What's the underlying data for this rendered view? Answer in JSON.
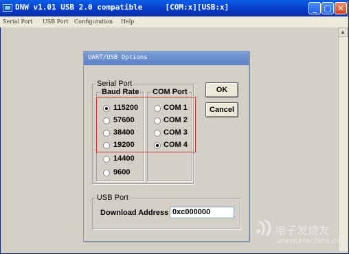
{
  "window": {
    "title": "DNW v1.01 USB 2.0 compatible     [COM:x][USB:x]",
    "controls": {
      "minimize": "_",
      "maximize": "□",
      "close": "✕"
    }
  },
  "menu": {
    "items": [
      "Serial Port",
      "USB Port",
      "Configuration",
      "Help"
    ]
  },
  "dialog": {
    "title": "UART/USB Options",
    "serial_port": {
      "label": "Serial Port",
      "baud_rate": {
        "label": "Baud Rate",
        "options": [
          "115200",
          "57600",
          "38400",
          "19200",
          "14400",
          "9600"
        ],
        "selected": "115200"
      },
      "com_port": {
        "label": "COM Port",
        "options": [
          "COM 1",
          "COM 2",
          "COM 3",
          "COM 4"
        ],
        "selected": "COM 4"
      }
    },
    "usb_port": {
      "label": "USB Port",
      "download_address_label": "Download Address",
      "download_address_value": "0xc000000"
    },
    "buttons": {
      "ok": "OK",
      "cancel": "Cancel"
    },
    "highlight_color": "#e03030"
  },
  "watermark": {
    "text": "电子发烧友",
    "url": "www.elecfans.com"
  },
  "icons": [
    "app-icon",
    "minimize-icon",
    "maximize-icon",
    "close-icon",
    "scroll-up-arrow-icon",
    "watermark-logo-icon"
  ]
}
